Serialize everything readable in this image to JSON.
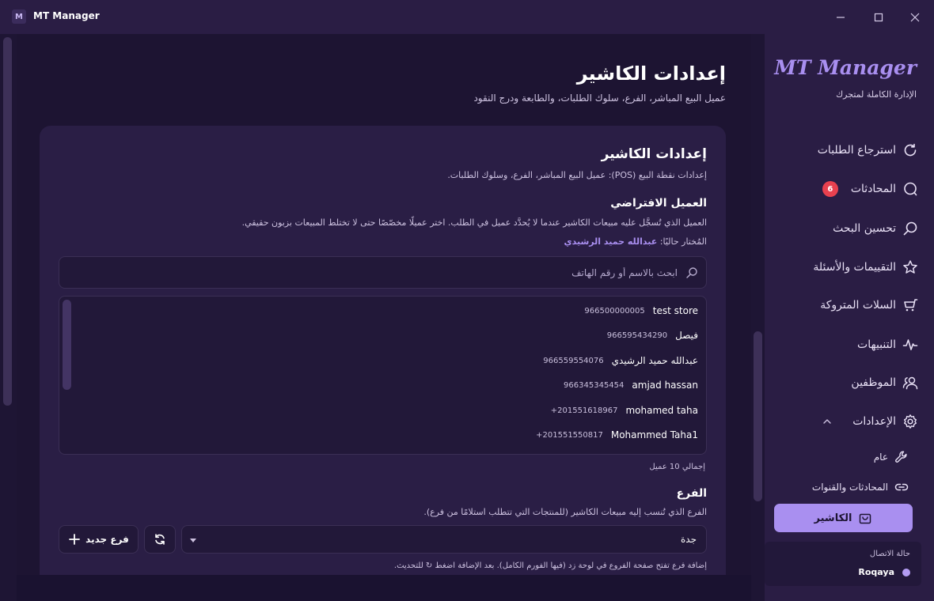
{
  "window": {
    "app_icon_letter": "M",
    "title": "MT Manager"
  },
  "sidebar": {
    "brand": "MT Manager",
    "brand_sub": "الإدارة الكاملة لمتجرك",
    "items": [
      {
        "label": "استرجاع الطلبات",
        "icon": "refresh-icon"
      },
      {
        "label": "المحادثات",
        "icon": "chat-bubble-icon",
        "badge": "6"
      },
      {
        "label": "تحسين البحث",
        "icon": "search-icon"
      },
      {
        "label": "التقييمات والأسئلة",
        "icon": "star-icon"
      },
      {
        "label": "السلات المتروكة",
        "icon": "cart-icon"
      },
      {
        "label": "التنبيهات",
        "icon": "pulse-icon"
      },
      {
        "label": "الموظفين",
        "icon": "users-icon"
      },
      {
        "label": "الإعدادات",
        "icon": "gear-icon"
      }
    ],
    "sub_items": [
      {
        "label": "عام",
        "icon": "wrench-icon"
      },
      {
        "label": "المحادثات والقنوات",
        "icon": "link-icon"
      }
    ],
    "active": {
      "label": "الكاشير",
      "icon": "shopping-bag-icon"
    },
    "connection": {
      "label": "حالة الاتصال",
      "name": "Roqaya",
      "color": "#b39cf2"
    }
  },
  "page": {
    "title": "إعدادات الكاشير",
    "subtitle": "عميل البيع المباشر، الفرع، سلوك الطلبات، والطابعة ودرج النقود"
  },
  "card": {
    "title": "إعدادات الكاشير",
    "subtitle": "إعدادات نقطة البيع (POS): عميل البيع المباشر، الفرع، وسلوك الطلبات.",
    "default_client": {
      "title": "العميل الافتراضي",
      "desc": "العميل الذي تُسجَّل عليه مبيعات الكاشير عندما لا يُحدَّد عميل في الطلب. اختر عميلًا مخصّصًا حتى لا تختلط المبيعات بزبون حقيقي.",
      "selected_label": "المُختار حاليًا:",
      "selected_value": "عبدالله حميد الرشيدي",
      "search_placeholder": "ابحث بالاسم أو رقم الهاتف",
      "clients": [
        {
          "name": "test store",
          "phone": "966500000005"
        },
        {
          "name": "فيصل",
          "phone": "966595434290"
        },
        {
          "name": "عبدالله حميد الرشيدي",
          "phone": "966559554076"
        },
        {
          "name": "amjad hassan",
          "phone": "966345345454"
        },
        {
          "name": "mohamed taha",
          "phone": "+201551618967"
        },
        {
          "name": "Mohammed Taha1",
          "phone": "+201551550817"
        }
      ],
      "total": "إجمالي 10 عميل"
    },
    "branch": {
      "title": "الفرع",
      "desc": "الفرع الذي تُنسب إليه مبيعات الكاشير (للمنتجات التي تتطلب استلامًا من فرع).",
      "selected": "جدة",
      "new_button": "فرع جديد",
      "note": "إضافة فرع تفتح صفحة الفروع في لوحة زد (فيها الفورم الكامل). بعد الإضافة اضغط ↻ للتحديث."
    }
  },
  "colors": {
    "accent": "#a98ff0",
    "badge": "#e8414f",
    "background": "#1c1330",
    "card": "#2a1e45"
  }
}
